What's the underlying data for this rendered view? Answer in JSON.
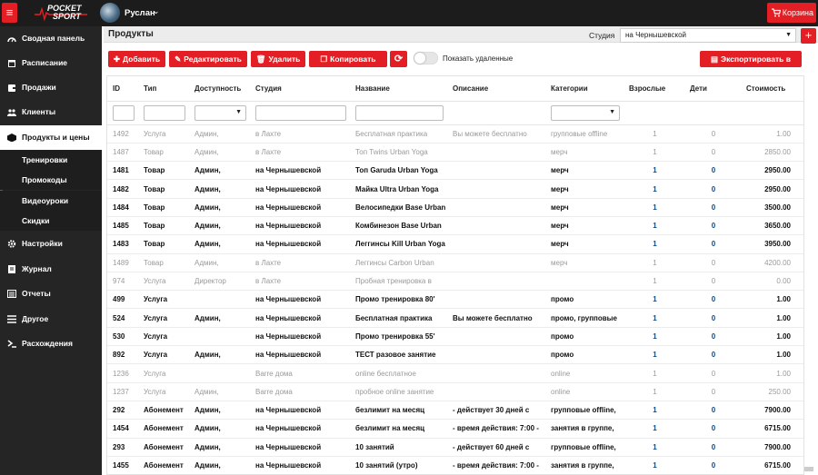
{
  "topbar": {
    "menu_icon": "hamburger-icon",
    "logo_line1": "POCKET",
    "logo_line2": "SPORT",
    "username": "Руслан",
    "cart_label": "Корзина"
  },
  "sidebar": {
    "items": [
      {
        "label": "Сводная панель",
        "icon": "dashboard-icon"
      },
      {
        "label": "Расписание",
        "icon": "calendar-icon"
      },
      {
        "label": "Продажи",
        "icon": "wallet-icon"
      },
      {
        "label": "Клиенты",
        "icon": "users-icon"
      },
      {
        "label": "Продукты и цены",
        "icon": "box-icon"
      },
      {
        "label": "Настройки",
        "icon": "gear-icon"
      },
      {
        "label": "Журнал",
        "icon": "journal-icon"
      },
      {
        "label": "Отчеты",
        "icon": "report-icon"
      },
      {
        "label": "Другое",
        "icon": "list-icon"
      },
      {
        "label": "Расхождения",
        "icon": "chart-icon"
      }
    ],
    "subitems": [
      "Тренировки",
      "Промокоды",
      "Видеоуроки",
      "Скидки"
    ]
  },
  "header": {
    "title": "Продукты",
    "studio_label": "Студия",
    "studio_value": "на Чернышевской"
  },
  "toolbar": {
    "add": "Добавить",
    "edit": "Редактировать",
    "delete": "Удалить",
    "copy": "Копировать",
    "show_deleted": "Показать удаленные",
    "export": "Экспортировать в Excel"
  },
  "table": {
    "columns": [
      "ID",
      "Тип",
      "Доступность",
      "Студия",
      "Название",
      "Описание",
      "Категории",
      "Взрослые",
      "Дети",
      "Стоимость"
    ],
    "rows": [
      {
        "state": "deleted",
        "cells": [
          "1492",
          "Услуга",
          "Админ,",
          "в Лахте",
          "Бесплатная практика",
          "Вы можете бесплатно",
          "групповые offline",
          "1",
          "0",
          "1.00"
        ]
      },
      {
        "state": "deleted",
        "cells": [
          "1487",
          "Товар",
          "Админ,",
          "в Лахте",
          "Топ Twins Urban Yoga",
          "",
          "мерч",
          "1",
          "0",
          "2850.00"
        ]
      },
      {
        "state": "active",
        "cells": [
          "1481",
          "Товар",
          "Админ,",
          "на Чернышевской",
          "Топ Garuda Urban Yoga",
          "",
          "мерч",
          "1",
          "0",
          "2950.00"
        ]
      },
      {
        "state": "active",
        "cells": [
          "1482",
          "Товар",
          "Админ,",
          "на Чернышевской",
          "Майка Ultra Urban Yoga",
          "",
          "мерч",
          "1",
          "0",
          "2950.00"
        ]
      },
      {
        "state": "active",
        "cells": [
          "1484",
          "Товар",
          "Админ,",
          "на Чернышевской",
          "Велосипедки Base Urban",
          "",
          "мерч",
          "1",
          "0",
          "3500.00"
        ]
      },
      {
        "state": "active",
        "cells": [
          "1485",
          "Товар",
          "Админ,",
          "на Чернышевской",
          "Комбинезон Base Urban",
          "",
          "мерч",
          "1",
          "0",
          "3650.00"
        ]
      },
      {
        "state": "active",
        "cells": [
          "1483",
          "Товар",
          "Админ,",
          "на Чернышевской",
          "Леггинсы Kill Urban Yoga",
          "",
          "мерч",
          "1",
          "0",
          "3950.00"
        ]
      },
      {
        "state": "deleted",
        "cells": [
          "1489",
          "Товар",
          "Админ,",
          "в Лахте",
          "Леггинсы Carbon Urban",
          "",
          "мерч",
          "1",
          "0",
          "4200.00"
        ]
      },
      {
        "state": "deleted",
        "cells": [
          "974",
          "Услуга",
          "Директор",
          "в Лахте",
          "Пробная тренировка в",
          "",
          "",
          "1",
          "0",
          "0.00"
        ]
      },
      {
        "state": "active",
        "cells": [
          "499",
          "Услуга",
          "",
          "на Чернышевской",
          "Промо тренировка 80'",
          "",
          "промо",
          "1",
          "0",
          "1.00"
        ]
      },
      {
        "state": "active",
        "cells": [
          "524",
          "Услуга",
          "Админ,",
          "на Чернышевской",
          "Бесплатная практика",
          "Вы можете бесплатно",
          "промо, групповые",
          "1",
          "0",
          "1.00"
        ]
      },
      {
        "state": "active",
        "cells": [
          "530",
          "Услуга",
          "",
          "на Чернышевской",
          "Промо тренировка 55'",
          "",
          "промо",
          "1",
          "0",
          "1.00"
        ]
      },
      {
        "state": "active",
        "cells": [
          "892",
          "Услуга",
          "Админ,",
          "на Чернышевской",
          "ТЕСТ разовое занятие",
          "",
          "промо",
          "1",
          "0",
          "1.00"
        ]
      },
      {
        "state": "deleted",
        "cells": [
          "1236",
          "Услуга",
          "",
          "Ваrre дома",
          "online бесплатное",
          "",
          "online",
          "1",
          "0",
          "1.00"
        ]
      },
      {
        "state": "deleted",
        "cells": [
          "1237",
          "Услуга",
          "Админ,",
          "Ваrre дома",
          "пробное online занятие",
          "",
          "online",
          "1",
          "0",
          "250.00"
        ]
      },
      {
        "state": "active",
        "cells": [
          "292",
          "Абонемент",
          "Админ,",
          "на Чернышевской",
          "безлимит на месяц",
          "- действует 30 дней с",
          "групповые offline,",
          "1",
          "0",
          "7900.00"
        ]
      },
      {
        "state": "active",
        "cells": [
          "1454",
          "Абонемент",
          "Админ,",
          "на Чернышевской",
          "безлимит на месяц",
          "- время действия: 7:00 -",
          "занятия в группе,",
          "1",
          "0",
          "6715.00"
        ]
      },
      {
        "state": "active",
        "cells": [
          "293",
          "Абонемент",
          "Админ,",
          "на Чернышевской",
          "10 занятий",
          "- действует 60 дней с",
          "групповые offline,",
          "1",
          "0",
          "7900.00"
        ]
      },
      {
        "state": "active",
        "cells": [
          "1455",
          "Абонемент",
          "Админ,",
          "на Чернышевской",
          "10 занятий (утро)",
          "- время действия: 7:00 -",
          "занятия в группе,",
          "1",
          "0",
          "6715.00"
        ]
      }
    ]
  }
}
